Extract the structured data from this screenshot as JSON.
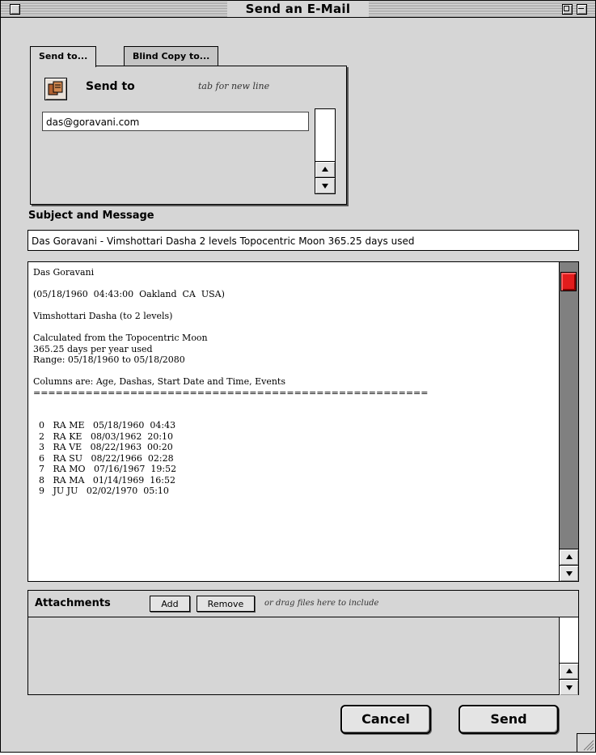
{
  "window": {
    "title": "Send an E-Mail"
  },
  "tabs": [
    {
      "label": "Send to...",
      "active": true
    },
    {
      "label": "Blind Copy to...",
      "active": false
    }
  ],
  "recipients": {
    "heading": "Send to",
    "hint": "tab for new line",
    "to_value": "das@goravani.com"
  },
  "subject": {
    "label": "Subject and Message",
    "value": "Das Goravani - Vimshottari Dasha 2 levels Topocentric Moon 365.25 days used"
  },
  "message": {
    "body": "Das Goravani\n\n(05/18/1960  04:43:00  Oakland  CA  USA)\n\nVimshottari Dasha (to 2 levels)\n\nCalculated from the Topocentric Moon\n365.25 days per year used\nRange: 05/18/1960 to 05/18/2080\n\nColumns are: Age, Dashas, Start Date and Time, Events\n=====================================================\n\n\n  0   RA ME   05/18/1960  04:43\n  2   RA KE   08/03/1962  20:10\n  3   RA VE   08/22/1963  00:20\n  6   RA SU   08/22/1966  02:28\n  7   RA MO   07/16/1967  19:52\n  8   RA MA   01/14/1969  16:52\n  9   JU JU   02/02/1970  05:10"
  },
  "attachments": {
    "label": "Attachments",
    "add_label": "Add",
    "remove_label": "Remove",
    "hint": "or drag files here to include"
  },
  "buttons": {
    "cancel": "Cancel",
    "send": "Send"
  },
  "colors": {
    "window_bg": "#d6d6d6",
    "scroll_thumb": "#e21c1c"
  }
}
